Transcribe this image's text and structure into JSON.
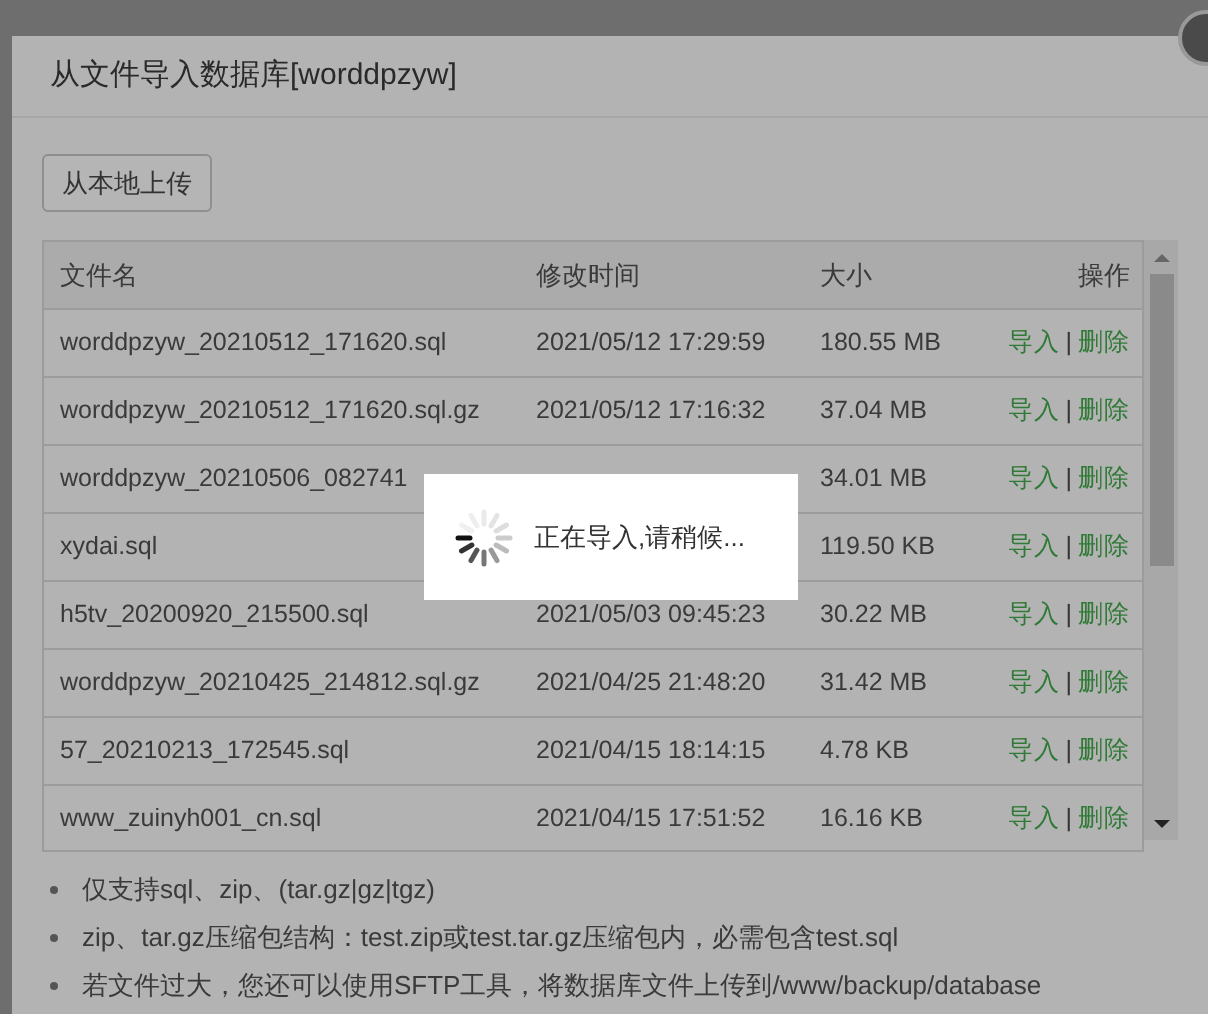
{
  "dialog": {
    "title": "从文件导入数据库[worddpzyw]"
  },
  "upload_button": "从本地上传",
  "table": {
    "columns": [
      "文件名",
      "修改时间",
      "大小",
      "操作"
    ],
    "rows": [
      {
        "name": "worddpzyw_20210512_171620.sql",
        "modified": "2021/05/12 17:29:59",
        "size": "180.55 MB",
        "import": "导入",
        "separator": "|",
        "delete": "删除"
      },
      {
        "name": "worddpzyw_20210512_171620.sql.gz",
        "modified": "2021/05/12 17:16:32",
        "size": "37.04 MB",
        "import": "导入",
        "separator": "|",
        "delete": "删除"
      },
      {
        "name": "worddpzyw_20210506_082741",
        "size": "34.01 MB",
        "import": "导入",
        "separator": "|",
        "delete": "删除"
      },
      {
        "name": "xydai.sql",
        "size": "119.50 KB",
        "import": "导入",
        "separator": "|",
        "delete": "删除"
      },
      {
        "name": "h5tv_20200920_215500.sql",
        "modified": "2021/05/03 09:45:23",
        "size": "30.22 MB",
        "import": "导入",
        "separator": "|",
        "delete": "删除"
      },
      {
        "name": "worddpzyw_20210425_214812.sql.gz",
        "modified": "2021/04/25 21:48:20",
        "size": "31.42 MB",
        "import": "导入",
        "separator": "|",
        "delete": "删除"
      },
      {
        "name": "57_20210213_172545.sql",
        "modified": "2021/04/15 18:14:15",
        "size": "4.78 KB",
        "import": "导入",
        "separator": "|",
        "delete": "删除"
      },
      {
        "name": "www_zuinyh001_cn.sql",
        "modified": "2021/04/15 17:51:52",
        "size": "16.16 KB",
        "import": "导入",
        "separator": "|",
        "delete": "删除"
      }
    ]
  },
  "notes": [
    "仅支持sql、zip、(tar.gz|gz|tgz)",
    "zip、tar.gz压缩包结构：test.zip或test.tar.gz压缩包内，必需包含test.sql",
    "若文件过大，您还可以使用SFTP工具，将数据库文件上传到/www/backup/database"
  ],
  "loading": {
    "message": "正在导入,请稍候..."
  }
}
